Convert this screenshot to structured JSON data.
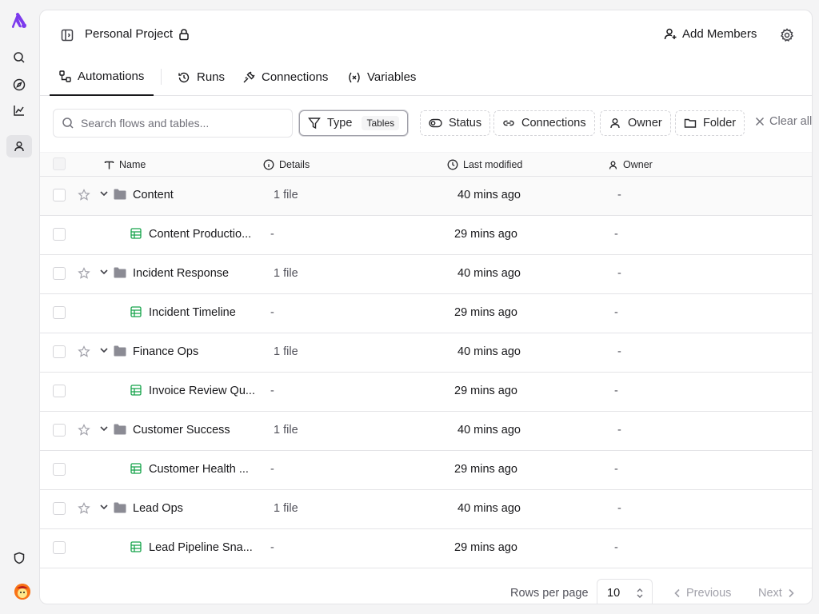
{
  "project": {
    "title": "Personal Project"
  },
  "header": {
    "add_members_label": "Add Members"
  },
  "tabs": [
    {
      "label": "Automations",
      "active": true
    },
    {
      "label": "Runs"
    },
    {
      "label": "Connections"
    },
    {
      "label": "Variables"
    }
  ],
  "search": {
    "placeholder": "Search flows and tables...",
    "value": ""
  },
  "filters": {
    "type_label": "Type",
    "type_badge": "Tables",
    "status_label": "Status",
    "connections_label": "Connections",
    "owner_label": "Owner",
    "folder_label": "Folder",
    "clear_all_label": "Clear all"
  },
  "table": {
    "columns": {
      "name": "Name",
      "details": "Details",
      "last_modified": "Last modified",
      "owner": "Owner"
    },
    "rows": [
      {
        "kind": "folder",
        "name": "Content",
        "details": "1 file",
        "modified": "40 mins ago",
        "owner": "-"
      },
      {
        "kind": "table",
        "name": "Content Productio...",
        "details": "-",
        "modified": "29 mins ago",
        "owner": "-"
      },
      {
        "kind": "folder",
        "name": "Incident Response",
        "details": "1 file",
        "modified": "40 mins ago",
        "owner": "-"
      },
      {
        "kind": "table",
        "name": "Incident Timeline",
        "details": "-",
        "modified": "29 mins ago",
        "owner": "-"
      },
      {
        "kind": "folder",
        "name": "Finance Ops",
        "details": "1 file",
        "modified": "40 mins ago",
        "owner": "-"
      },
      {
        "kind": "table",
        "name": "Invoice Review Qu...",
        "details": "-",
        "modified": "29 mins ago",
        "owner": "-"
      },
      {
        "kind": "folder",
        "name": "Customer Success",
        "details": "1 file",
        "modified": "40 mins ago",
        "owner": "-"
      },
      {
        "kind": "table",
        "name": "Customer Health ...",
        "details": "-",
        "modified": "29 mins ago",
        "owner": "-"
      },
      {
        "kind": "folder",
        "name": "Lead Ops",
        "details": "1 file",
        "modified": "40 mins ago",
        "owner": "-"
      },
      {
        "kind": "table",
        "name": "Lead Pipeline Sna...",
        "details": "-",
        "modified": "29 mins ago",
        "owner": "-"
      }
    ]
  },
  "pagination": {
    "rows_per_page_label": "Rows per page",
    "rows_per_page": "10",
    "previous_label": "Previous",
    "next_label": "Next"
  },
  "colors": {
    "brand": "#7c3aed",
    "table_icon": "#16a34a",
    "folder_icon": "#71717a"
  }
}
